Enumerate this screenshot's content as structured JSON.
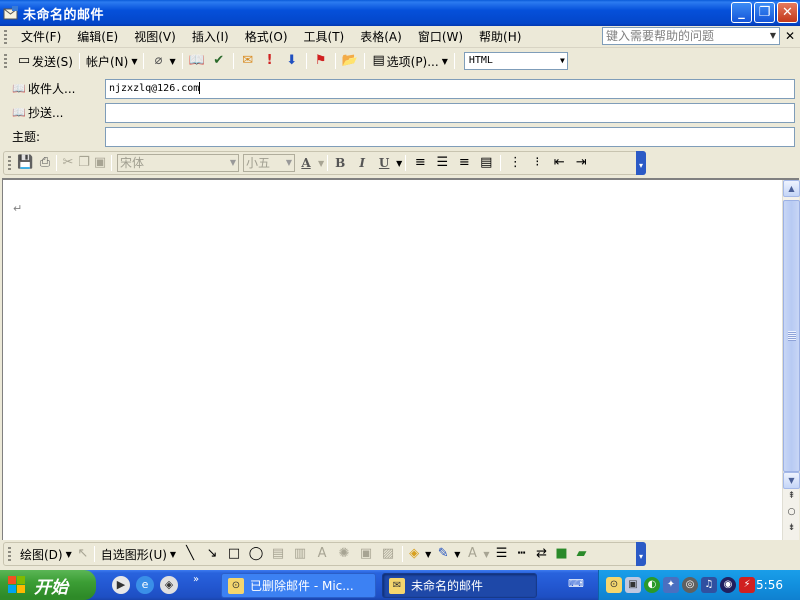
{
  "window": {
    "title": "未命名的邮件"
  },
  "menu": {
    "items": [
      "文件(F)",
      "编辑(E)",
      "视图(V)",
      "插入(I)",
      "格式(O)",
      "工具(T)",
      "表格(A)",
      "窗口(W)",
      "帮助(H)"
    ],
    "help_placeholder": "键入需要帮助的问题"
  },
  "toolbar": {
    "send": "发送(S)",
    "account": "帐户(N)",
    "options": "选项(P)...",
    "format": "HTML"
  },
  "fields": {
    "to_label": "收件人...",
    "to_value": "njzxzlq@126.com",
    "cc_label": "抄送...",
    "cc_value": "",
    "subject_label": "主题:",
    "subject_value": ""
  },
  "formatting": {
    "font": "宋体",
    "size": "小五",
    "bold": "B",
    "italic": "I",
    "underline": "U",
    "font_color": "A"
  },
  "document": {
    "paragraph_mark": "↵"
  },
  "drawing": {
    "draw": "绘图(D)",
    "autoshapes": "自选图形(U)"
  },
  "taskbar": {
    "start": "开始",
    "tasks": [
      "已删除邮件 - Mic...",
      "未命名的邮件"
    ],
    "clock": "5:56"
  },
  "colors": {
    "titlebar": "#0550DA",
    "taskbar": "#2358D2",
    "start": "#3C9E35",
    "tray": "#1290DE"
  }
}
